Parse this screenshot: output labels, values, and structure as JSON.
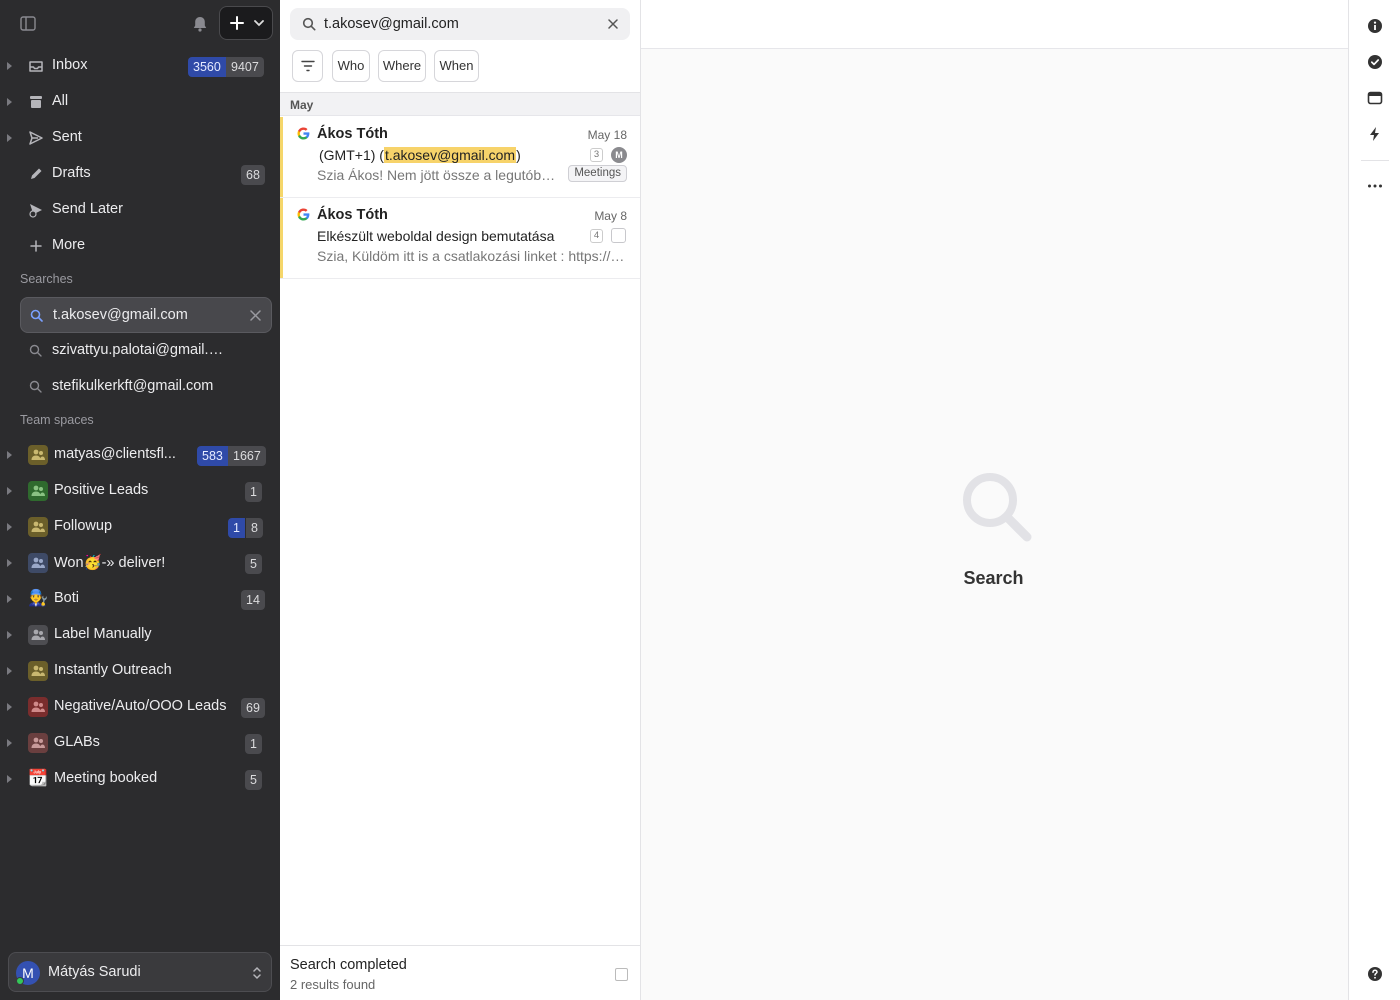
{
  "sidebar": {
    "nav": [
      {
        "label": "Inbox",
        "icon": "inbox-icon",
        "unread": "3560",
        "total": "9407"
      },
      {
        "label": "All",
        "icon": "archive-icon"
      },
      {
        "label": "Sent",
        "icon": "send-icon"
      },
      {
        "label": "Drafts",
        "icon": "pencil-icon",
        "count": "68"
      },
      {
        "label": "Send Later",
        "icon": "send-later-icon"
      },
      {
        "label": "More",
        "icon": "plus-icon"
      }
    ],
    "searches_title": "Searches",
    "searches": [
      {
        "label": "t.akosev@gmail.com"
      },
      {
        "label": "szivattyu.palotai@gmail.com"
      },
      {
        "label": "stefikulkerkft@gmail.com"
      }
    ],
    "team_title": "Team spaces",
    "teams": [
      {
        "label": "matyas@clientsfl...",
        "color": "#8a7a3a",
        "unread": "583",
        "total": "1667"
      },
      {
        "label": "Positive Leads",
        "color": "#3f7a3a",
        "count": "1"
      },
      {
        "label": "Followup",
        "color": "#8a7a3a",
        "unread": "1",
        "total": "8"
      },
      {
        "label": "Won🥳-» deliver!",
        "color": "#4a5a7a",
        "count": "5"
      },
      {
        "label": "Boti",
        "emoji": "👨‍🔧",
        "count": "14"
      },
      {
        "label": "Label Manually",
        "color": "#5a5a5e"
      },
      {
        "label": "Instantly Outreach",
        "color": "#7a6a3a"
      },
      {
        "label": "Negative/Auto/OOO Leads",
        "color": "#8a3535",
        "count": "69"
      },
      {
        "label": "GLABs",
        "color": "#7a4a4a",
        "count": "1"
      },
      {
        "label": "Meeting booked",
        "emoji": "📆",
        "count": "5"
      }
    ],
    "user": {
      "name": "Mátyás Sarudi",
      "initial": "M"
    }
  },
  "list": {
    "query": "t.akosev@gmail.com",
    "filters": [
      "Who",
      "Where",
      "When"
    ],
    "group": "May",
    "messages": [
      {
        "from": "Ákos Tóth",
        "date": "May 18",
        "subject_pre": "(GMT+1) (",
        "subject_hl": "t.akosev@gmail.com",
        "subject_post": ")",
        "preview": "Szia Ákos! Nem jött össze a legutóbbi…",
        "thread_count": "3",
        "assignee": "M",
        "label": "Meetings"
      },
      {
        "from": "Ákos Tóth",
        "date": "May 8",
        "subject": "Elkészült weboldal design bemutatása",
        "preview": "Szia, Küldöm itt is a csatlakozási linket : https://meet.google.com",
        "thread_count": "4"
      }
    ],
    "footer_status": "Search completed",
    "footer_count": "2 results found"
  },
  "detail": {
    "empty_label": "Search"
  },
  "rail": [
    "info-icon",
    "check-circle-icon",
    "calendar-icon",
    "bolt-icon",
    "more-icon",
    "help-icon"
  ],
  "colors": {
    "sidebar_bg": "#2c2c2e",
    "highlight": "#f7d36a",
    "unread_badge": "#2f4aa8"
  }
}
